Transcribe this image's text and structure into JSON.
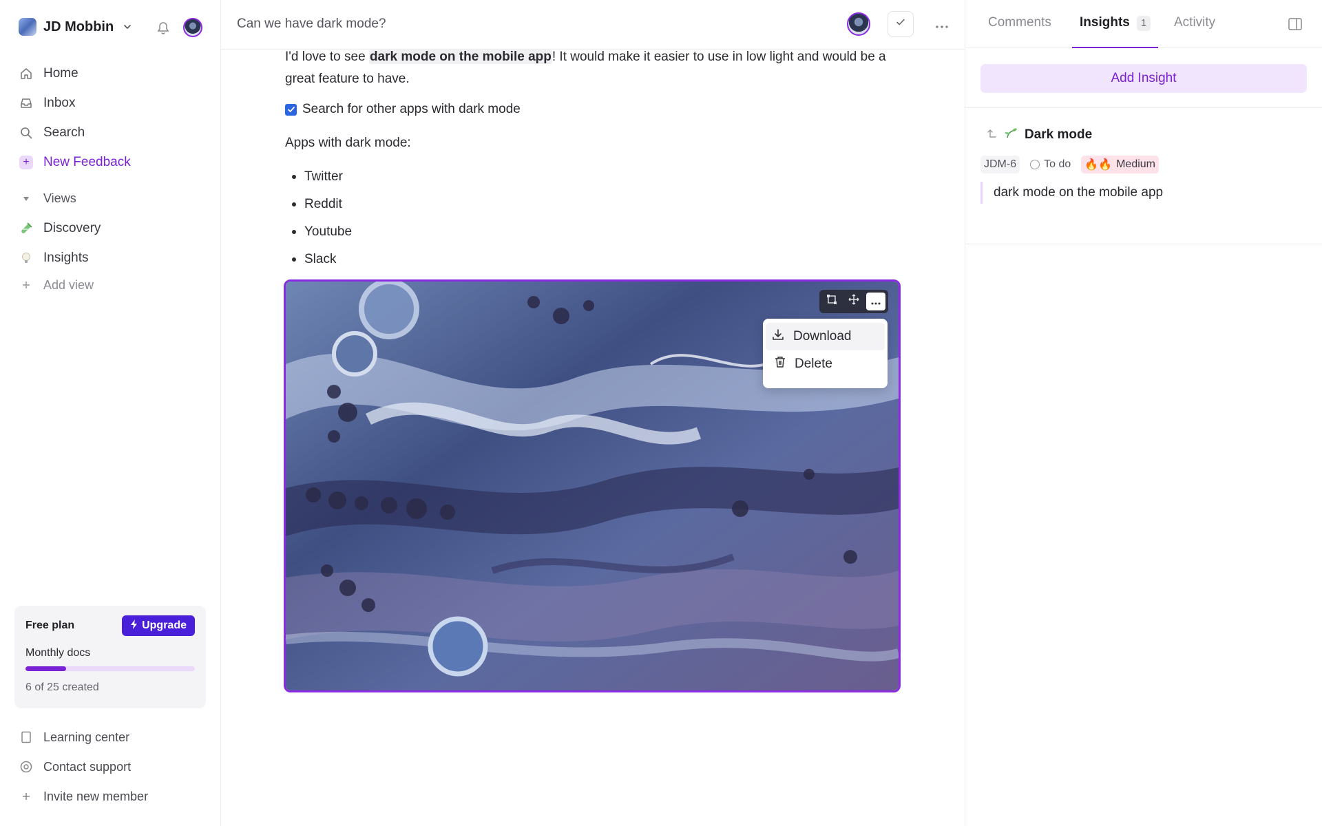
{
  "workspace": {
    "name": "JD Mobbin"
  },
  "sidebar": {
    "nav": [
      {
        "label": "Home",
        "icon": "home-icon"
      },
      {
        "label": "Inbox",
        "icon": "inbox-icon"
      },
      {
        "label": "Search",
        "icon": "search-icon"
      },
      {
        "label": "New Feedback",
        "icon": "plus-icon"
      }
    ],
    "views_header": "Views",
    "views": [
      {
        "label": "Discovery",
        "icon": "test-tube-icon"
      },
      {
        "label": "Insights",
        "icon": "lightbulb-icon"
      }
    ],
    "add_view": "Add view",
    "plan": {
      "title": "Free plan",
      "upgrade": "Upgrade",
      "docs_label": "Monthly docs",
      "docs_count": "6 of 25 created",
      "used": 6,
      "limit": 25
    },
    "footer": [
      {
        "label": "Learning center",
        "icon": "book-icon"
      },
      {
        "label": "Contact support",
        "icon": "lifebuoy-icon"
      },
      {
        "label": "Invite new member",
        "icon": "plus-icon"
      }
    ]
  },
  "doc": {
    "title": "Can we have dark mode?",
    "para_before": "I'd love to see ",
    "para_bold": "dark mode on the mobile app",
    "para_after": "! It would make it easier to use in low light and would be a great feature to have.",
    "todo": "Search for other apps with dark mode",
    "todo_checked": true,
    "apps_heading": "Apps with dark mode:",
    "apps": [
      "Twitter",
      "Reddit",
      "Youtube",
      "Slack"
    ],
    "image_menu": {
      "download": "Download",
      "delete": "Delete"
    }
  },
  "right": {
    "tabs": [
      {
        "label": "Comments"
      },
      {
        "label": "Insights",
        "badge": "1",
        "active": true
      },
      {
        "label": "Activity"
      }
    ],
    "add_insight": "Add Insight",
    "insight": {
      "title": "Dark mode",
      "id": "JDM-6",
      "status": "To do",
      "priority": "Medium",
      "priority_emoji": "🔥🔥",
      "quote": "dark mode on the mobile app"
    }
  },
  "colors": {
    "accent": "#7a22d6",
    "upgrade": "#4a1fd9",
    "checkbox": "#2b66e0"
  }
}
